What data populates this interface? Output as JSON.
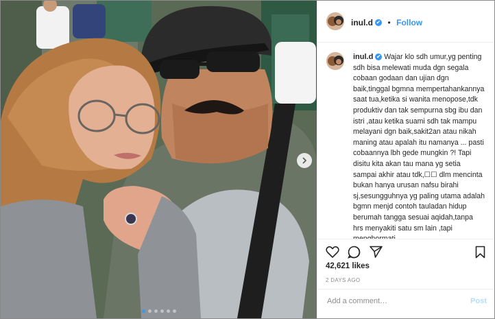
{
  "post": {
    "username": "inul.d",
    "verified_mark": "✔",
    "follow_label": "Follow",
    "separator": "•",
    "caption": "Wajar klo sdh umur,yg penting sdh bisa melewati muda dgn segala cobaan godaan dan ujian dgn baik,tinggal bgmna mempertahankannya saat tua,ketika si wanita menopose,tdk produktiv dan tak sempurna sbg ibu dan istri ,atau ketika suami sdh tak mampu melayani dgn baik,sakit2an atau nikah maning atau apalah itu namanya ... pasti cobaannya lbh gede mungkin ?! Tapi disitu kita akan tau mana yg setia sampai akhir atau tdk,☐☐ dlm mencinta bukan hanya urusan nafsu birahi sj,sesungguhnya yg paling utama adalah bgmn menjd contoh tauladan hidup berumah tangga sesuai aqidah,tanpa hrs menyakiti satu sm lain ,tapi menghormati",
    "likes": "42,621 likes",
    "time_ago": "2 DAYS AGO",
    "comment_placeholder": "Add a comment…",
    "post_label": "Post"
  },
  "carousel": {
    "total_slides": 6,
    "active_slide": 1
  },
  "icons": {
    "like": "heart-icon",
    "comment": "comment-bubble-icon",
    "share": "paper-plane-icon",
    "save": "bookmark-icon",
    "next": "chevron-right-icon"
  },
  "colors": {
    "accent": "#3897f0",
    "post_disabled": "#b2dffc",
    "muted": "#8e8e8e",
    "text": "#262626"
  }
}
